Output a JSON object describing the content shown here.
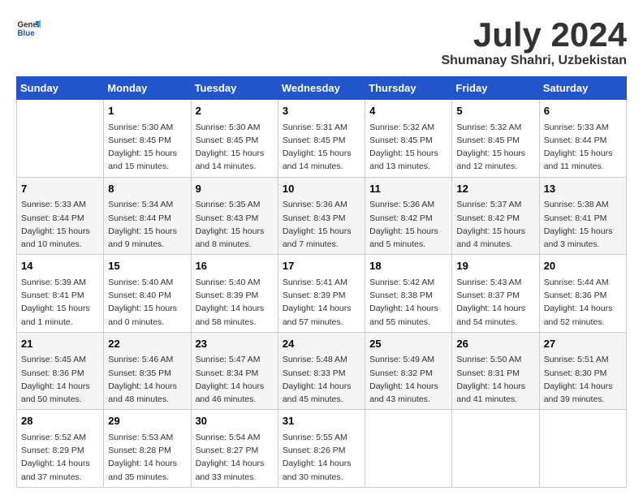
{
  "header": {
    "logo_general": "General",
    "logo_blue": "Blue",
    "main_title": "July 2024",
    "subtitle": "Shumanay Shahri, Uzbekistan"
  },
  "calendar": {
    "days_of_week": [
      "Sunday",
      "Monday",
      "Tuesday",
      "Wednesday",
      "Thursday",
      "Friday",
      "Saturday"
    ],
    "weeks": [
      [
        {
          "day": "",
          "info": ""
        },
        {
          "day": "1",
          "info": "Sunrise: 5:30 AM\nSunset: 8:45 PM\nDaylight: 15 hours\nand 15 minutes."
        },
        {
          "day": "2",
          "info": "Sunrise: 5:30 AM\nSunset: 8:45 PM\nDaylight: 15 hours\nand 14 minutes."
        },
        {
          "day": "3",
          "info": "Sunrise: 5:31 AM\nSunset: 8:45 PM\nDaylight: 15 hours\nand 14 minutes."
        },
        {
          "day": "4",
          "info": "Sunrise: 5:32 AM\nSunset: 8:45 PM\nDaylight: 15 hours\nand 13 minutes."
        },
        {
          "day": "5",
          "info": "Sunrise: 5:32 AM\nSunset: 8:45 PM\nDaylight: 15 hours\nand 12 minutes."
        },
        {
          "day": "6",
          "info": "Sunrise: 5:33 AM\nSunset: 8:44 PM\nDaylight: 15 hours\nand 11 minutes."
        }
      ],
      [
        {
          "day": "7",
          "info": "Sunrise: 5:33 AM\nSunset: 8:44 PM\nDaylight: 15 hours\nand 10 minutes."
        },
        {
          "day": "8",
          "info": "Sunrise: 5:34 AM\nSunset: 8:44 PM\nDaylight: 15 hours\nand 9 minutes."
        },
        {
          "day": "9",
          "info": "Sunrise: 5:35 AM\nSunset: 8:43 PM\nDaylight: 15 hours\nand 8 minutes."
        },
        {
          "day": "10",
          "info": "Sunrise: 5:36 AM\nSunset: 8:43 PM\nDaylight: 15 hours\nand 7 minutes."
        },
        {
          "day": "11",
          "info": "Sunrise: 5:36 AM\nSunset: 8:42 PM\nDaylight: 15 hours\nand 5 minutes."
        },
        {
          "day": "12",
          "info": "Sunrise: 5:37 AM\nSunset: 8:42 PM\nDaylight: 15 hours\nand 4 minutes."
        },
        {
          "day": "13",
          "info": "Sunrise: 5:38 AM\nSunset: 8:41 PM\nDaylight: 15 hours\nand 3 minutes."
        }
      ],
      [
        {
          "day": "14",
          "info": "Sunrise: 5:39 AM\nSunset: 8:41 PM\nDaylight: 15 hours\nand 1 minute."
        },
        {
          "day": "15",
          "info": "Sunrise: 5:40 AM\nSunset: 8:40 PM\nDaylight: 15 hours\nand 0 minutes."
        },
        {
          "day": "16",
          "info": "Sunrise: 5:40 AM\nSunset: 8:39 PM\nDaylight: 14 hours\nand 58 minutes."
        },
        {
          "day": "17",
          "info": "Sunrise: 5:41 AM\nSunset: 8:39 PM\nDaylight: 14 hours\nand 57 minutes."
        },
        {
          "day": "18",
          "info": "Sunrise: 5:42 AM\nSunset: 8:38 PM\nDaylight: 14 hours\nand 55 minutes."
        },
        {
          "day": "19",
          "info": "Sunrise: 5:43 AM\nSunset: 8:37 PM\nDaylight: 14 hours\nand 54 minutes."
        },
        {
          "day": "20",
          "info": "Sunrise: 5:44 AM\nSunset: 8:36 PM\nDaylight: 14 hours\nand 52 minutes."
        }
      ],
      [
        {
          "day": "21",
          "info": "Sunrise: 5:45 AM\nSunset: 8:36 PM\nDaylight: 14 hours\nand 50 minutes."
        },
        {
          "day": "22",
          "info": "Sunrise: 5:46 AM\nSunset: 8:35 PM\nDaylight: 14 hours\nand 48 minutes."
        },
        {
          "day": "23",
          "info": "Sunrise: 5:47 AM\nSunset: 8:34 PM\nDaylight: 14 hours\nand 46 minutes."
        },
        {
          "day": "24",
          "info": "Sunrise: 5:48 AM\nSunset: 8:33 PM\nDaylight: 14 hours\nand 45 minutes."
        },
        {
          "day": "25",
          "info": "Sunrise: 5:49 AM\nSunset: 8:32 PM\nDaylight: 14 hours\nand 43 minutes."
        },
        {
          "day": "26",
          "info": "Sunrise: 5:50 AM\nSunset: 8:31 PM\nDaylight: 14 hours\nand 41 minutes."
        },
        {
          "day": "27",
          "info": "Sunrise: 5:51 AM\nSunset: 8:30 PM\nDaylight: 14 hours\nand 39 minutes."
        }
      ],
      [
        {
          "day": "28",
          "info": "Sunrise: 5:52 AM\nSunset: 8:29 PM\nDaylight: 14 hours\nand 37 minutes."
        },
        {
          "day": "29",
          "info": "Sunrise: 5:53 AM\nSunset: 8:28 PM\nDaylight: 14 hours\nand 35 minutes."
        },
        {
          "day": "30",
          "info": "Sunrise: 5:54 AM\nSunset: 8:27 PM\nDaylight: 14 hours\nand 33 minutes."
        },
        {
          "day": "31",
          "info": "Sunrise: 5:55 AM\nSunset: 8:26 PM\nDaylight: 14 hours\nand 30 minutes."
        },
        {
          "day": "",
          "info": ""
        },
        {
          "day": "",
          "info": ""
        },
        {
          "day": "",
          "info": ""
        }
      ]
    ]
  }
}
